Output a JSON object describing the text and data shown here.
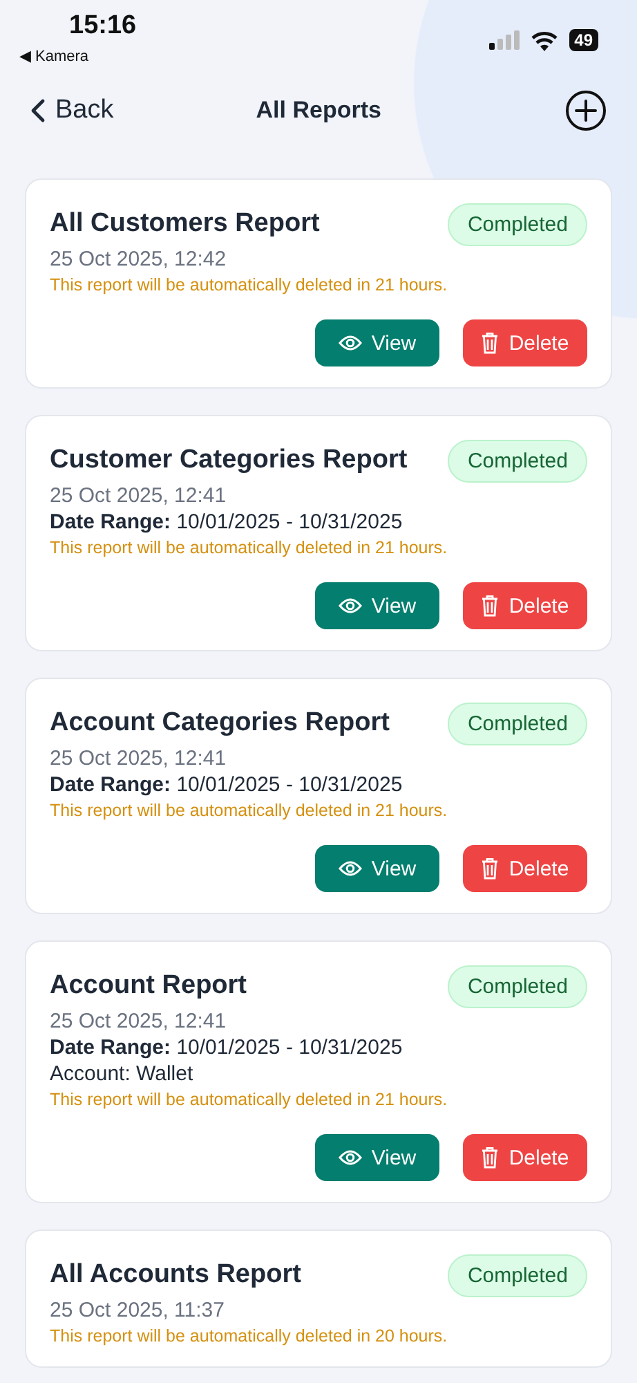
{
  "status_bar": {
    "time": "15:16",
    "back_app": "◀ Kamera",
    "battery": "49"
  },
  "nav": {
    "back": "Back",
    "title": "All Reports"
  },
  "reports": [
    {
      "title": "All Customers Report",
      "status": "Completed",
      "date": "25 Oct 2025, 12:42",
      "notice": "This report will be automatically deleted in 21 hours.",
      "actions": [
        {
          "kind": "view",
          "label": "View"
        },
        {
          "kind": "delete",
          "label": "Delete"
        }
      ]
    },
    {
      "title": "Customer Categories Report",
      "status": "Completed",
      "date": "25 Oct 2025, 12:41",
      "details": [
        "**Date Range:** 10/01/2025 - 10/31/2025"
      ],
      "notice": "This report will be automatically deleted in 21 hours.",
      "actions": [
        {
          "kind": "view",
          "label": "View"
        },
        {
          "kind": "delete",
          "label": "Delete"
        }
      ]
    },
    {
      "title": "Account Categories Report",
      "status": "Completed",
      "date": "25 Oct 2025, 12:41",
      "details": [
        "**Date Range:** 10/01/2025 - 10/31/2025"
      ],
      "notice": "This report will be automatically deleted in 21 hours.",
      "actions": [
        {
          "kind": "view",
          "label": "View"
        },
        {
          "kind": "delete",
          "label": "Delete"
        }
      ]
    },
    {
      "title": "Account Report",
      "status": "Completed",
      "date": "25 Oct 2025, 12:41",
      "details": [
        "**Date Range:** 10/01/2025 - 10/31/2025",
        "Account: Wallet"
      ],
      "notice": "This report will be automatically deleted in 21 hours.",
      "actions": [
        {
          "kind": "view",
          "label": "View"
        },
        {
          "kind": "delete",
          "label": "Delete"
        }
      ]
    },
    {
      "title": "All Accounts Report",
      "status": "Completed",
      "date": "25 Oct 2025, 11:37",
      "notice": "This report will be automatically deleted in 20 hours."
    }
  ]
}
